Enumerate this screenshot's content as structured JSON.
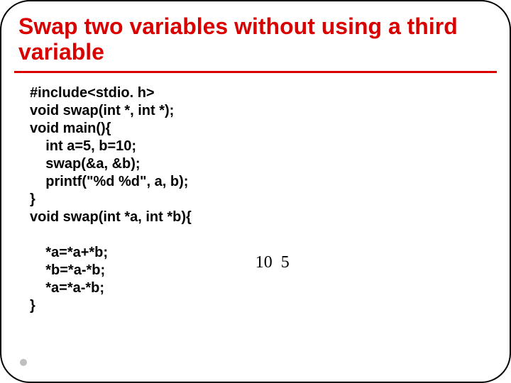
{
  "title": "Swap two variables without using a third variable",
  "code": "#include<stdio. h>\nvoid swap(int *, int *);\nvoid main(){\n    int a=5, b=10;\n    swap(&a, &b);\n    printf(\"%d %d\", a, b);\n}\nvoid swap(int *a, int *b){\n\n    *a=*a+*b;\n    *b=*a-*b;\n    *a=*a-*b;\n}",
  "output": "10  5"
}
